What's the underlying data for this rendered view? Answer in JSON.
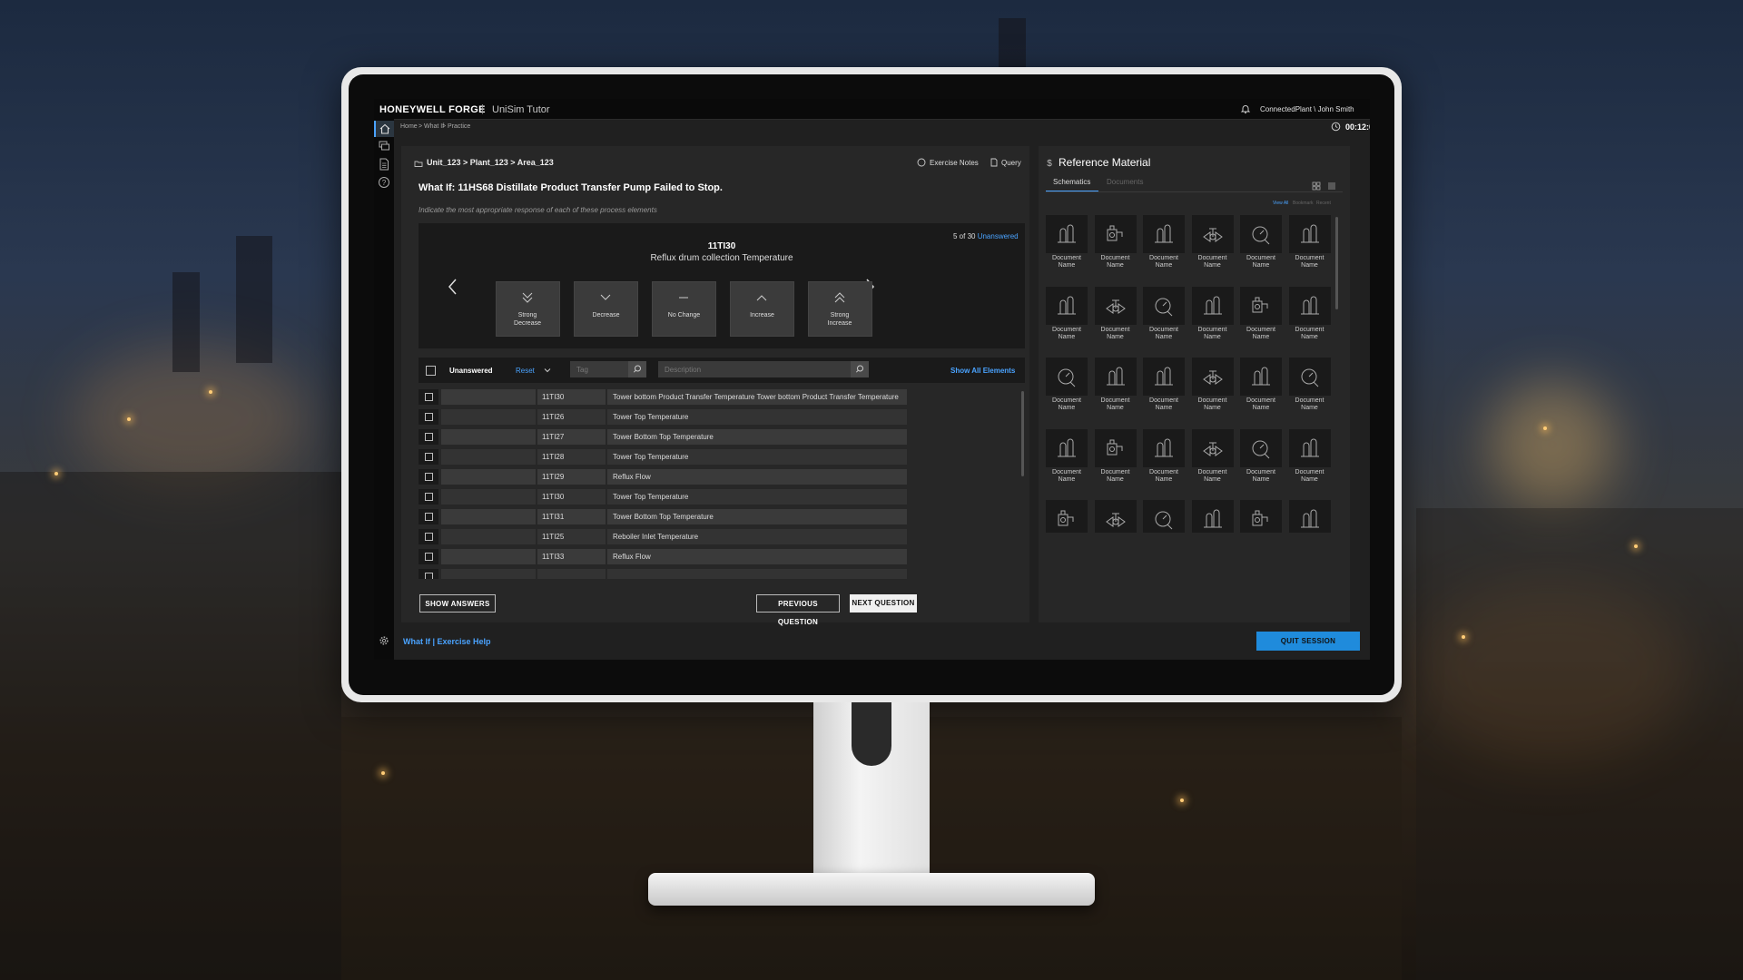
{
  "app": {
    "brand": "HONEYWELL FORGE",
    "separator": "|",
    "product": "UniSim Tutor",
    "user": "ConnectedPlant \\ John Smith"
  },
  "breadcrumb": [
    "Home",
    ">",
    "What If",
    ">",
    "Practice"
  ],
  "timer": "00:12:00",
  "sidebar": {
    "items": [
      {
        "icon": "home-icon"
      },
      {
        "icon": "layers-icon"
      },
      {
        "icon": "document-icon"
      },
      {
        "icon": "help-icon"
      }
    ],
    "settings_icon": "gear-icon"
  },
  "exercise": {
    "path": "Unit_123 > Plant_123 > Area_123",
    "notes_label": "Exercise Notes",
    "query_label": "Query",
    "question_title": "What If: 11HS68 Distillate Product Transfer Pump Failed to Stop.",
    "instruction": "Indicate the most appropriate response of each of these process elements",
    "progress_count": "5 of 30",
    "progress_status": "Unanswered",
    "current_tag": "11TI30",
    "current_description": "Reflux drum collection Temperature",
    "choices": [
      {
        "label": "Strong Decrease",
        "icon": "double-chevron-down-icon"
      },
      {
        "label": "Decrease",
        "icon": "chevron-down-icon"
      },
      {
        "label": "No Change",
        "icon": "dash-icon"
      },
      {
        "label": "Increase",
        "icon": "chevron-up-icon"
      },
      {
        "label": "Strong Increase",
        "icon": "double-chevron-up-icon"
      }
    ]
  },
  "filter": {
    "status_label": "Unanswered",
    "reset_label": "Reset",
    "tag_placeholder": "Tag",
    "description_placeholder": "Description",
    "show_all_label": "Show All Elements"
  },
  "table": {
    "rows": [
      {
        "tag": "11TI30",
        "description": "Tower bottom Product Transfer Temperature Tower bottom Product Transfer Temperature"
      },
      {
        "tag": "11TI26",
        "description": "Tower Top Temperature"
      },
      {
        "tag": "11TI27",
        "description": "Tower Bottom Top Temperature"
      },
      {
        "tag": "11TI28",
        "description": "Tower Top Temperature"
      },
      {
        "tag": "11TI29",
        "description": "Reflux Flow"
      },
      {
        "tag": "11TI30",
        "description": "Tower Top Temperature"
      },
      {
        "tag": "11TI31",
        "description": "Tower Bottom Top Temperature"
      },
      {
        "tag": "11TI25",
        "description": "Reboiler Inlet Temperature"
      },
      {
        "tag": "11TI33",
        "description": "Reflux Flow"
      }
    ]
  },
  "buttons": {
    "show_answers": "SHOW ANSWERS",
    "previous_question": "PREVIOUS QUESTION",
    "next_question": "NEXT QUESTION",
    "quit_session": "QUIT SESSION"
  },
  "help_link": "What If | Exercise Help",
  "reference": {
    "title": "Reference Material",
    "tabs": [
      "Schematics",
      "Documents"
    ],
    "sort_options": [
      "View All",
      "Bookmark",
      "Recent"
    ],
    "doc_label": "Document Name",
    "doc_icons": [
      "column-icon",
      "pump-icon",
      "column-icon",
      "valve-icon",
      "gauge-icon",
      "column-icon",
      "column-icon",
      "valve-icon",
      "gauge-icon",
      "column-icon",
      "pump-icon",
      "column-icon",
      "gauge-icon",
      "column-icon",
      "column-icon",
      "valve-icon",
      "column-icon",
      "gauge-icon",
      "column-icon",
      "pump-icon",
      "column-icon",
      "valve-icon",
      "gauge-icon",
      "column-icon",
      "pump-icon",
      "valve-icon",
      "gauge-icon",
      "column-icon",
      "pump-icon",
      "column-icon",
      "column-icon",
      "gauge-icon",
      "column-icon",
      "valve-icon",
      "column-icon",
      "gauge-icon"
    ]
  },
  "colors": {
    "accent": "#4aa3ff",
    "quit_button": "#1f8bdc",
    "panel": "#272727",
    "background": "#202020"
  }
}
